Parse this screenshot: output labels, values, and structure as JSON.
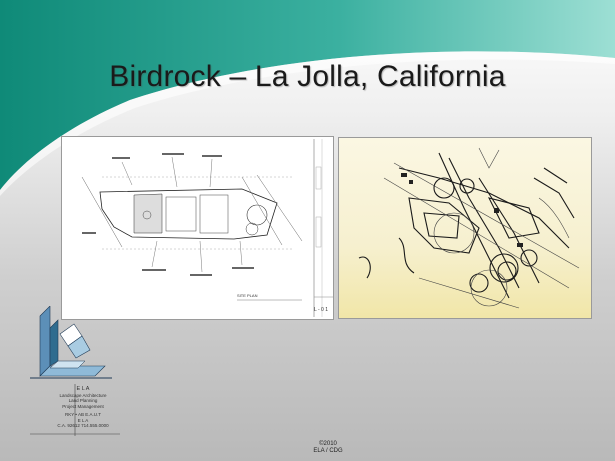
{
  "slide": {
    "title": "Birdrock – La Jolla, California",
    "plan_sheet_label": "L - 0 1",
    "plan_caption": "SITE PLAN",
    "footer_copyright": "©2010",
    "footer_org": "ELA / CDG"
  },
  "logo": {
    "name": "E L A",
    "lines": [
      "Landscape Architecture",
      "Land Planning",
      "Project Management"
    ],
    "sub_lines": [
      "RKY • AB E.A.U.T",
      "E L A",
      "C.A. 92612 714.555.0000"
    ]
  },
  "colors": {
    "teal": "#1f9a8a",
    "teal_light": "#7fd0c4",
    "logo_blue": "#5c8fb8"
  }
}
